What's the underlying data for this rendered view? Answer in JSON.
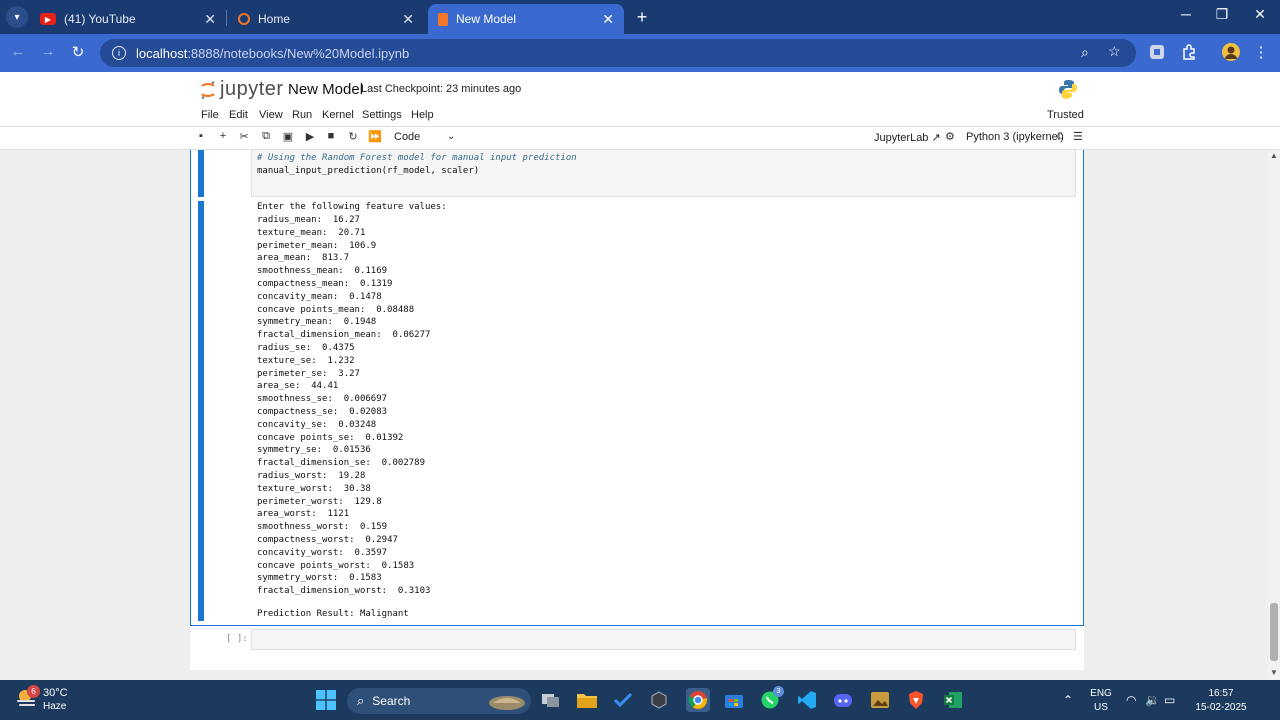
{
  "browser": {
    "tabs": [
      {
        "title": "(41) YouTube",
        "icon": "youtube-icon"
      },
      {
        "title": "Home",
        "icon": "jupyter-icon"
      },
      {
        "title": "New Model",
        "icon": "notebook-icon",
        "active": true
      }
    ],
    "url_host": "localhost",
    "url_path": ":8888/notebooks/New%20Model.ipynb"
  },
  "jupyter": {
    "logo_text": "jupyter",
    "notebook_title": "New Model",
    "checkpoint": "Last Checkpoint: 23 minutes ago",
    "menu": [
      "File",
      "Edit",
      "View",
      "Run",
      "Kernel",
      "Settings",
      "Help"
    ],
    "trusted": "Trusted",
    "cell_type": "Code",
    "jupyterlab_link": "JupyterLab",
    "kernel": "Python 3 (ipykernel)"
  },
  "cell": {
    "code_lines": [
      "# Using the Random Forest model for manual input prediction",
      "manual_input_prediction(rf_model, scaler)"
    ],
    "output_header": "Enter the following feature values:",
    "features": [
      {
        "name": "radius_mean",
        "value": "16.27"
      },
      {
        "name": "texture_mean",
        "value": "20.71"
      },
      {
        "name": "perimeter_mean",
        "value": "106.9"
      },
      {
        "name": "area_mean",
        "value": "813.7"
      },
      {
        "name": "smoothness_mean",
        "value": "0.1169"
      },
      {
        "name": "compactness_mean",
        "value": "0.1319"
      },
      {
        "name": "concavity_mean",
        "value": "0.1478"
      },
      {
        "name": "concave points_mean",
        "value": "0.08488"
      },
      {
        "name": "symmetry_mean",
        "value": "0.1948"
      },
      {
        "name": "fractal_dimension_mean",
        "value": "0.06277"
      },
      {
        "name": "radius_se",
        "value": "0.4375"
      },
      {
        "name": "texture_se",
        "value": "1.232"
      },
      {
        "name": "perimeter_se",
        "value": "3.27"
      },
      {
        "name": "area_se",
        "value": "44.41"
      },
      {
        "name": "smoothness_se",
        "value": "0.006697"
      },
      {
        "name": "compactness_se",
        "value": "0.02083"
      },
      {
        "name": "concavity_se",
        "value": "0.03248"
      },
      {
        "name": "concave points_se",
        "value": "0.01392"
      },
      {
        "name": "symmetry_se",
        "value": "0.01536"
      },
      {
        "name": "fractal_dimension_se",
        "value": "0.002789"
      },
      {
        "name": "radius_worst",
        "value": "19.28"
      },
      {
        "name": "texture_worst",
        "value": "30.38"
      },
      {
        "name": "perimeter_worst",
        "value": "129.8"
      },
      {
        "name": "area_worst",
        "value": "1121"
      },
      {
        "name": "smoothness_worst",
        "value": "0.159"
      },
      {
        "name": "compactness_worst",
        "value": "0.2947"
      },
      {
        "name": "concavity_worst",
        "value": "0.3597"
      },
      {
        "name": "concave points_worst",
        "value": "0.1583"
      },
      {
        "name": "symmetry_worst",
        "value": "0.1583"
      },
      {
        "name": "fractal_dimension_worst",
        "value": "0.3103"
      }
    ],
    "result": "Prediction Result: Malignant",
    "empty_prompt": "[ ]:"
  },
  "taskbar": {
    "temperature": "30°C",
    "weather": "Haze",
    "weather_badge": "6",
    "search": "Search",
    "language": "ENG",
    "region": "US",
    "time": "16:57",
    "date": "15-02-2025",
    "whatsapp_badge": "3"
  },
  "colors": {
    "tab_strip": "#1a3a72",
    "address_bar": "#3a6ad0",
    "cell_accent": "#1976d2",
    "taskbar": "#1c3a5e"
  }
}
